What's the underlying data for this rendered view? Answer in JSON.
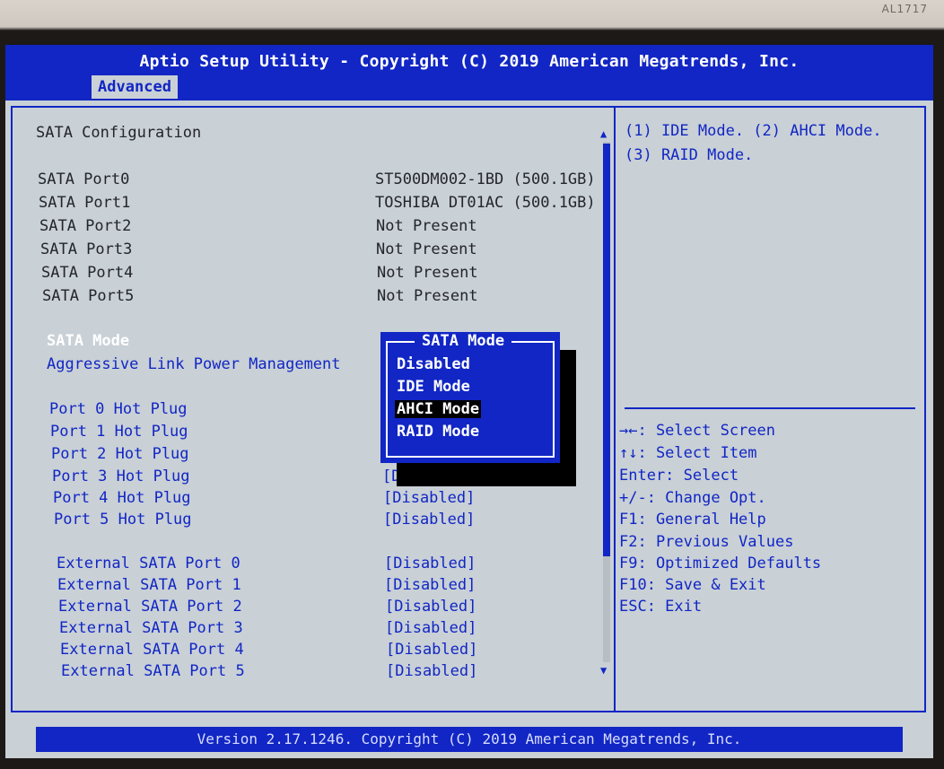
{
  "bezel": {
    "model_label": "AL1717"
  },
  "header": {
    "title": "Aptio Setup Utility - Copyright (C) 2019 American Megatrends, Inc.",
    "active_tab": "Advanced"
  },
  "section_title": "SATA Configuration",
  "ports": [
    {
      "label": "SATA Port0",
      "value": "ST500DM002-1BD (500.1GB)"
    },
    {
      "label": "SATA Port1",
      "value": "TOSHIBA DT01AC (500.1GB)"
    },
    {
      "label": "SATA Port2",
      "value": "Not Present"
    },
    {
      "label": "SATA Port3",
      "value": "Not Present"
    },
    {
      "label": "SATA Port4",
      "value": "Not Present"
    },
    {
      "label": "SATA Port5",
      "value": "Not Present"
    }
  ],
  "settings": {
    "sata_mode": "SATA Mode",
    "alpm": "Aggressive Link Power Management"
  },
  "hot_plug": [
    {
      "label": "Port 0 Hot Plug",
      "value": ""
    },
    {
      "label": "Port 1 Hot Plug",
      "value": ""
    },
    {
      "label": "Port 2 Hot Plug",
      "value": ""
    },
    {
      "label": "Port 3 Hot Plug",
      "value": "[D"
    },
    {
      "label": "Port 4 Hot Plug",
      "value": "[Disabled]"
    },
    {
      "label": "Port 5 Hot Plug",
      "value": "[Disabled]"
    }
  ],
  "external": [
    {
      "label": "External SATA Port 0",
      "value": "[Disabled]"
    },
    {
      "label": "External SATA Port 1",
      "value": "[Disabled]"
    },
    {
      "label": "External SATA Port 2",
      "value": "[Disabled]"
    },
    {
      "label": "External SATA Port 3",
      "value": "[Disabled]"
    },
    {
      "label": "External SATA Port 4",
      "value": "[Disabled]"
    },
    {
      "label": "External SATA Port 5",
      "value": "[Disabled]"
    }
  ],
  "popup": {
    "title": "SATA Mode",
    "options": [
      "Disabled",
      "IDE Mode",
      "AHCI Mode",
      "RAID Mode"
    ],
    "selected": "AHCI Mode"
  },
  "help": {
    "line1": "(1) IDE Mode. (2) AHCI Mode.",
    "line2": "(3) RAID Mode."
  },
  "keys": [
    "→←: Select Screen",
    "↑↓: Select Item",
    "Enter: Select",
    "+/-: Change Opt.",
    "F1: General Help",
    "F2: Previous Values",
    "F9: Optimized Defaults",
    "F10: Save & Exit",
    "ESC: Exit"
  ],
  "footer": {
    "version": "Version 2.17.1246. Copyright (C) 2019 American Megatrends, Inc."
  },
  "colors": {
    "bios_blue": "#1126c4",
    "screen_bg": "#c9d0d6",
    "text_dark": "#23252a"
  },
  "icons": {
    "scroll_up": "up-triangle",
    "scroll_down": "down-triangle"
  }
}
